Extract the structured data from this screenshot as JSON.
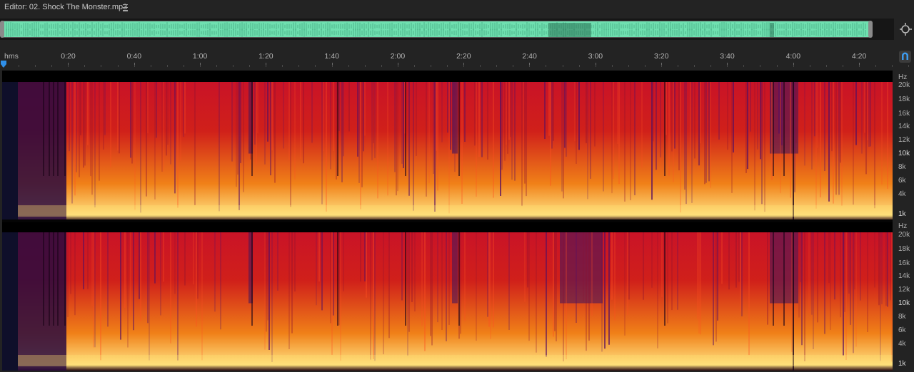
{
  "editor": {
    "title": "Editor: 02. Shock The Monster.mp3",
    "menu_icon": "hamburger-menu-icon"
  },
  "overview": {
    "waveform_color": "#6fe0b0",
    "zoom_icon": "zoom-navigator-icon"
  },
  "timeline": {
    "unit_label": "hms",
    "ticks": [
      "0:20",
      "0:40",
      "1:00",
      "1:20",
      "1:40",
      "2:00",
      "2:20",
      "2:40",
      "3:00",
      "3:20",
      "3:40",
      "4:00",
      "4:20"
    ],
    "snap_icon": "magnet-snap-icon"
  },
  "spectral": {
    "channels": [
      {
        "unit": "Hz",
        "labels": [
          {
            "text": "20k",
            "major": false
          },
          {
            "text": "18k",
            "major": false
          },
          {
            "text": "16k",
            "major": false
          },
          {
            "text": "14k",
            "major": false
          },
          {
            "text": "12k",
            "major": false
          },
          {
            "text": "10k",
            "major": true
          },
          {
            "text": "8k",
            "major": false
          },
          {
            "text": "6k",
            "major": false
          },
          {
            "text": "4k",
            "major": false
          },
          {
            "text": "1k",
            "major": true
          }
        ]
      },
      {
        "unit": "Hz",
        "labels": [
          {
            "text": "20k",
            "major": false
          },
          {
            "text": "18k",
            "major": false
          },
          {
            "text": "16k",
            "major": false
          },
          {
            "text": "14k",
            "major": false
          },
          {
            "text": "12k",
            "major": false
          },
          {
            "text": "10k",
            "major": true
          },
          {
            "text": "8k",
            "major": false
          },
          {
            "text": "6k",
            "major": false
          },
          {
            "text": "4k",
            "major": false
          },
          {
            "text": "1k",
            "major": true
          }
        ]
      }
    ],
    "colors": {
      "low": "#2a0a3a",
      "mid": "#c8102a",
      "high": "#f08018",
      "peak": "#ffe080"
    }
  }
}
